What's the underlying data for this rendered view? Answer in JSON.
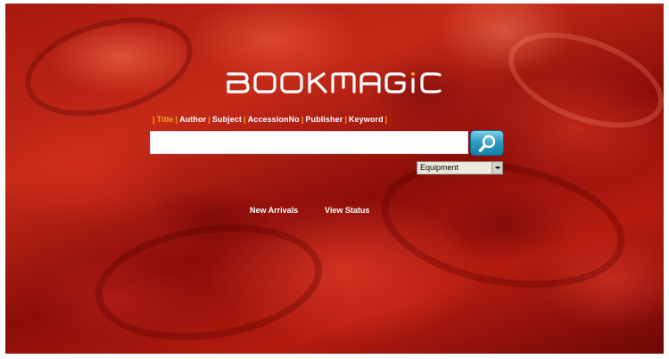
{
  "app": {
    "logo_text": "BOOKMAGIC"
  },
  "search": {
    "types": [
      {
        "label": "Title",
        "active": true
      },
      {
        "label": "Author",
        "active": false
      },
      {
        "label": "Subject",
        "active": false
      },
      {
        "label": "AccessionNo",
        "active": false
      },
      {
        "label": "Publisher",
        "active": false
      },
      {
        "label": "Keyword",
        "active": false
      }
    ],
    "separator": "|",
    "query": "",
    "placeholder": "",
    "button_icon": "magnifier-icon",
    "category": {
      "selected": "Equipment"
    }
  },
  "links": {
    "new_arrivals": "New Arrivals",
    "view_status": "View Status"
  },
  "colors": {
    "accent_orange": "#f4a31c",
    "search_button_blue": "#2e9cc4",
    "background_red": "#b51c10"
  }
}
